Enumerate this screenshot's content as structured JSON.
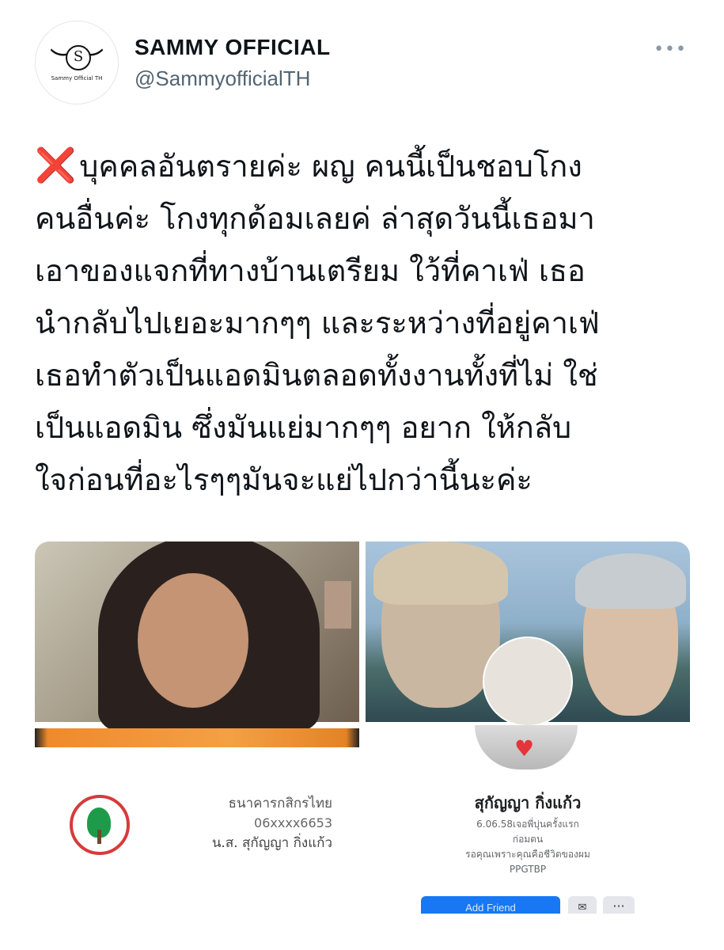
{
  "author": {
    "display_name": "SAMMY OFFICIAL",
    "handle": "@SammyofficialTH",
    "avatar_logo_text": "Sammy Official TH",
    "avatar_logo_letter": "S"
  },
  "more_label": "•••",
  "tweet": {
    "emoji": "❌",
    "lines": [
      "บุคคลอันตรายค่ะ ผญ คนนี้เป็นชอบโกง",
      "คนอื่นค่ะ โกงทุกด้อมเลยค่ ล่าสุดวันนี้เธอมา",
      "เอาของแจกที่ทางบ้านเตรียม ใว้ที่คาเฟ่ เธอ",
      "นำกลับไปเยอะมากๆๆ และระหว่างที่อยู่คาเฟ่",
      "เธอทำตัวเป็นแอดมินตลอดทั้งงานทั้งที่ไม่ ใช่",
      "เป็นแอดมิน ซึ่งมันแย่มากๆๆ อยาก ให้กลับ",
      "ใจก่อนที่อะไรๆๆมันจะแย่ไปกว่านี้นะค่ะ"
    ]
  },
  "media": {
    "bank": {
      "bank_name": "ธนาคารกสิกรไทย",
      "account_number": "06xxxx6653",
      "account_owner": "น.ส. สุกัญญา กิ่งแก้ว"
    },
    "profile": {
      "name": "สุกัญญา กิ่งแก้ว",
      "bio_lines": [
        "6.06.58เจอพี่บุ่นครั้งแรก",
        "ก่อมตน",
        "รอคุณเพราะคุณคือชีวิตของผม",
        "PPGTBP"
      ],
      "add_friend_label": "Add Friend",
      "messenger_icon": "messenger-icon",
      "more_label": "···"
    }
  },
  "colors": {
    "x_mark": "#e0242b",
    "handle": "#536471",
    "fb_blue": "#1877f2"
  }
}
